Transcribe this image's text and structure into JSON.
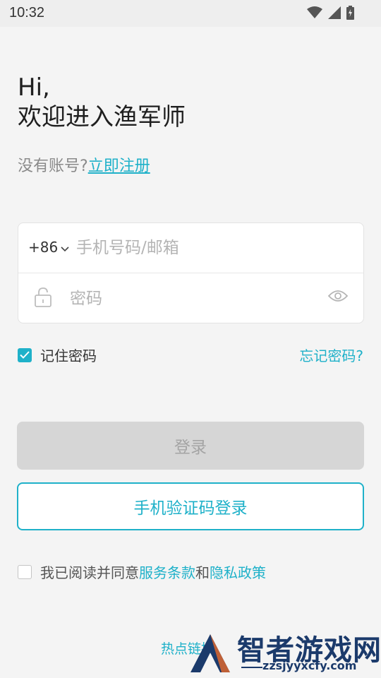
{
  "status_bar": {
    "time": "10:32",
    "icons": [
      "wifi-icon",
      "signal-icon",
      "battery-charging-icon"
    ]
  },
  "greeting": {
    "line1": "Hi,",
    "line2": "欢迎进入渔军师"
  },
  "register": {
    "prompt": "没有账号?",
    "link": "立即注册"
  },
  "form": {
    "country_code": "+86",
    "phone_placeholder": "手机号码/邮箱",
    "password_placeholder": "密码"
  },
  "remember": {
    "label": "记住密码",
    "checked": true
  },
  "forgot_label": "忘记密码?",
  "buttons": {
    "login": "登录",
    "sms_login": "手机验证码登录"
  },
  "agreement": {
    "prefix": "我已阅读并同意",
    "terms": "服务条款",
    "conjunction": "和",
    "privacy": "隐私政策",
    "checked": false
  },
  "bottom_link": "热点链接",
  "watermark": {
    "title": "智者游戏网",
    "url": "zzsjyyxcfy.com"
  },
  "colors": {
    "accent": "#1fb1c9",
    "background": "#f4f4f4",
    "disabled_button": "#d6d6d6"
  }
}
